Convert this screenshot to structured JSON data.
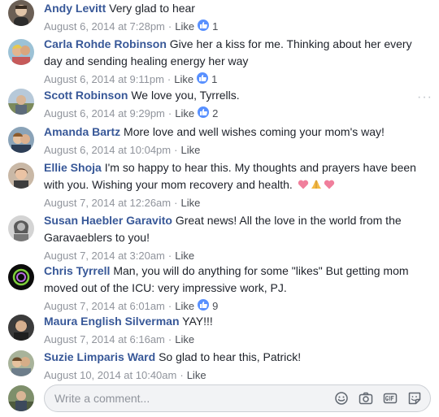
{
  "comments": [
    {
      "author": "Andy Levitt",
      "text": "Very glad to hear",
      "date": "August 6, 2014 at 7:28pm",
      "like": "Like",
      "reactions": "1"
    },
    {
      "author": "Carla Rohde Robinson",
      "text": "Give her a kiss for me. Thinking about her every day and sending healing energy her way",
      "date": "August 6, 2014 at 9:11pm",
      "like": "Like",
      "reactions": "1"
    },
    {
      "author": "Scott Robinson",
      "text": "We love you, Tyrrells.",
      "date": "August 6, 2014 at 9:29pm",
      "like": "Like",
      "reactions": "2",
      "more": "···"
    },
    {
      "author": "Amanda Bartz",
      "text": "More love and well wishes coming your mom's way!",
      "date": "August 6, 2014 at 10:04pm",
      "like": "Like"
    },
    {
      "author": "Ellie Shoja",
      "text": "I'm so happy to hear this. My thoughts and prayers have been with you. Wishing your mom recovery and health.",
      "date": "August 7, 2014 at 12:26am",
      "like": "Like",
      "emojis": [
        "pink-heart",
        "praying-hands",
        "pink-heart"
      ]
    },
    {
      "author": "Susan Haebler Garavito",
      "text": "Great news! All the love in the world from the Garavaeblers to you!",
      "date": "August 7, 2014 at 3:20am",
      "like": "Like"
    },
    {
      "author": "Chris Tyrrell",
      "text": "Man, you will do anything for some \"likes\" But getting mom moved out of the ICU: very impressive work, PJ.",
      "date": "August 7, 2014 at 6:01am",
      "like": "Like",
      "reactions": "9"
    },
    {
      "author": "Maura English Silverman",
      "text": "YAY!!!",
      "date": "August 7, 2014 at 6:16am",
      "like": "Like"
    },
    {
      "author": "Suzie Limparis Ward",
      "text": "So glad to hear this, Patrick!",
      "date": "August 10, 2014 at 10:40am",
      "like": "Like"
    }
  ],
  "composer": {
    "placeholder": "Write a comment...",
    "tools": [
      "emoji-icon",
      "camera-icon",
      "gif-icon",
      "sticker-icon"
    ]
  },
  "colors": {
    "author": "#385898",
    "meta": "#90949c",
    "like_reaction": "#5890ff"
  }
}
